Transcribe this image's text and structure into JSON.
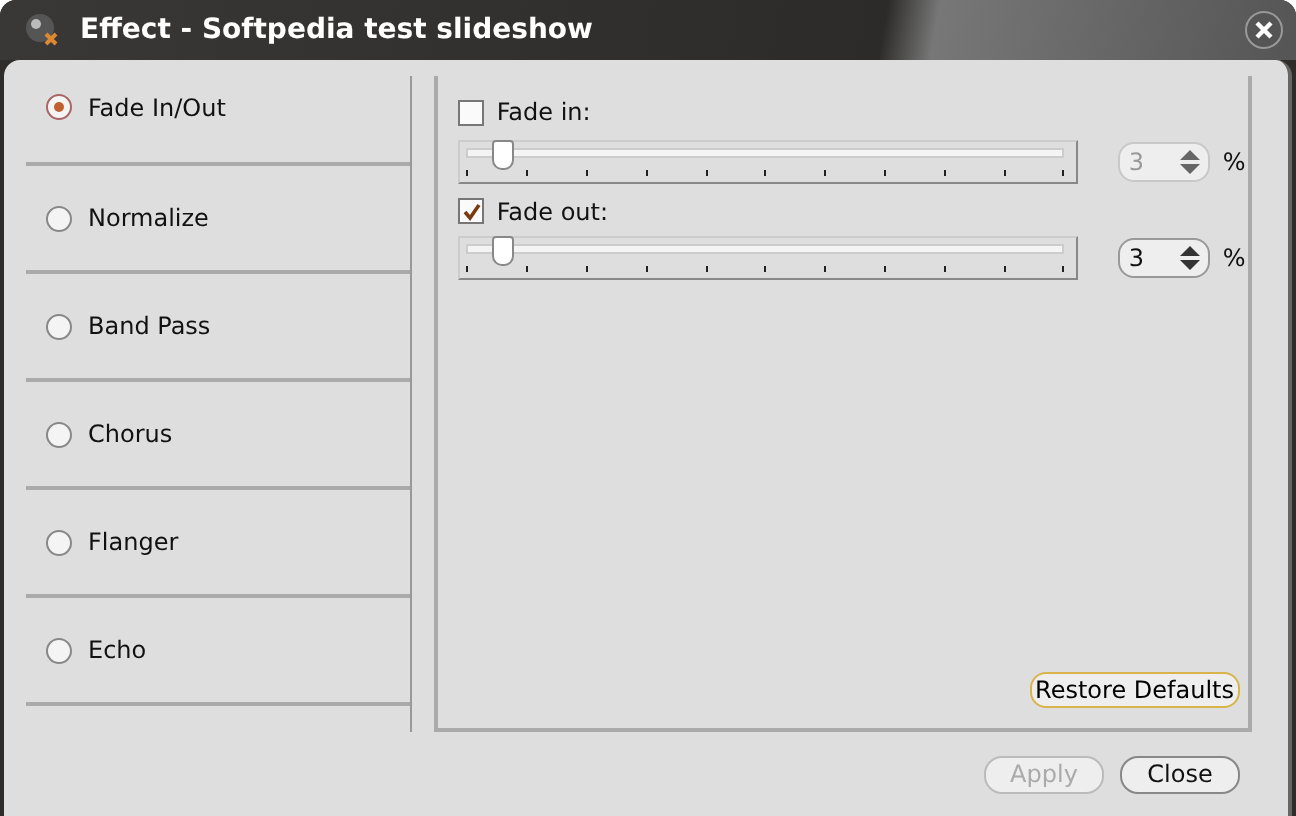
{
  "window": {
    "title": "Effect - Softpedia test slideshow"
  },
  "effects": [
    {
      "label": "Fade In/Out",
      "selected": true
    },
    {
      "label": "Normalize",
      "selected": false
    },
    {
      "label": "Band Pass",
      "selected": false
    },
    {
      "label": "Chorus",
      "selected": false
    },
    {
      "label": "Flanger",
      "selected": false
    },
    {
      "label": "Echo",
      "selected": false
    }
  ],
  "fades": [
    {
      "label": "Fade in:",
      "checked": false,
      "level": 0.04,
      "value": "3",
      "unit": "%"
    },
    {
      "label": "Fade out:",
      "checked": true,
      "level": 0.04,
      "value": "3",
      "unit": "%"
    }
  ],
  "restore_button": "Restore Defaults",
  "buttons": [
    {
      "label": "Apply",
      "disabled": true
    },
    {
      "label": "Close",
      "disabled": false
    }
  ]
}
